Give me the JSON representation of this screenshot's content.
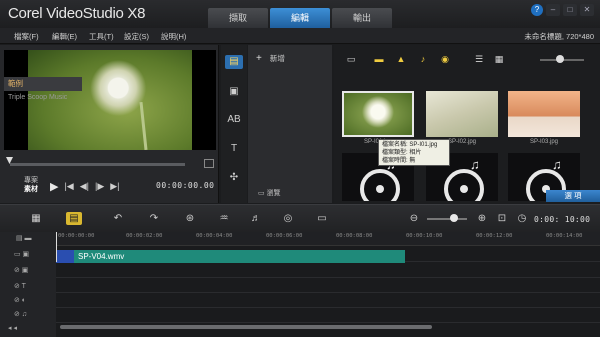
{
  "app": {
    "title": "Corel VideoStudio X8",
    "project": "未命名標題, 720*480"
  },
  "tabs": [
    "擷取",
    "編輯",
    "輸出"
  ],
  "window_buttons": [
    "?",
    "–",
    "□",
    "✕"
  ],
  "menu": [
    "檔案(F)",
    "編輯(E)",
    "工具(T)",
    "設定(S)",
    "說明(H)"
  ],
  "player": {
    "mode_labels": [
      "專案",
      "素材"
    ],
    "timecode": "00:00:00.00"
  },
  "library": {
    "add_label": "新增",
    "folder_active": "範例",
    "folder_item": "Triple Scoop Music",
    "browse_label": "瀏覽",
    "thumbs": [
      "SP-I01.jpg",
      "SP-I02.jpg",
      "SP-I03.jpg"
    ],
    "tooltip": [
      "檔案名稱: SP-I01.jpg",
      "檔案類型: 相片",
      "檔案時間: 無"
    ],
    "options_label": "選 項"
  },
  "timeline": {
    "time": "0:00: 10:00",
    "ruler": [
      "00:00:00:00",
      "00:00:02:00",
      "00:00:04:00",
      "00:00:06:00",
      "00:00:08:00",
      "00:00:10:00",
      "00:00:12:00",
      "00:00:14:00"
    ],
    "clip_name": "SP-V04.wmv"
  },
  "colors": {
    "accent": "#2c6fb0",
    "clip": "#1f8a7a",
    "folder_highlight": "#e6b56a"
  }
}
